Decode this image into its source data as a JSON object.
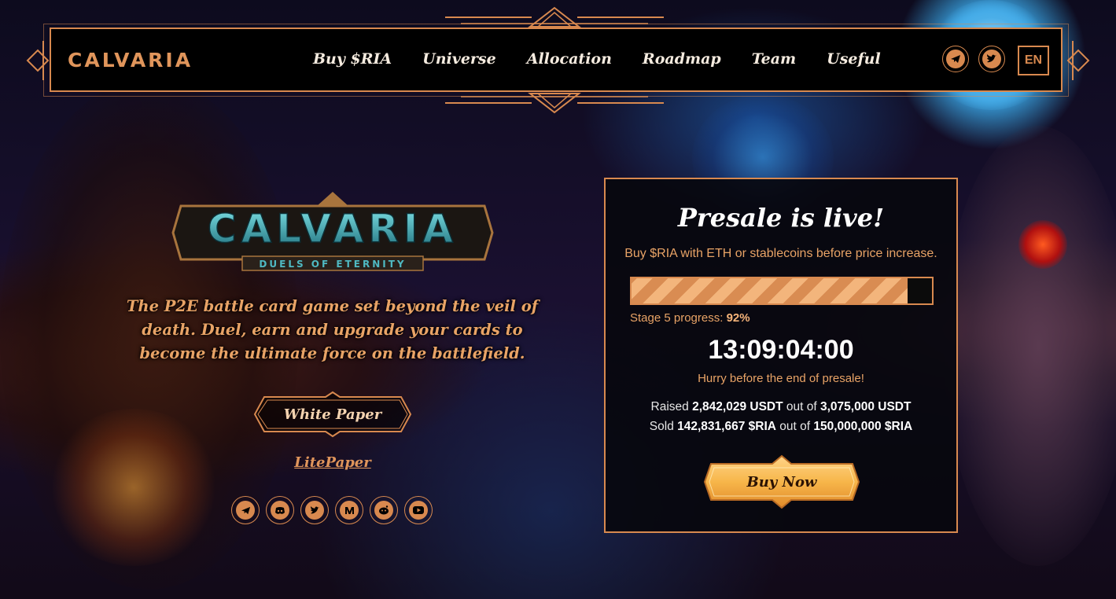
{
  "header": {
    "logo": "CALVARIA",
    "nav": [
      "Buy $RIA",
      "Universe",
      "Allocation",
      "Roadmap",
      "Team",
      "Useful"
    ],
    "social": [
      "telegram-icon",
      "twitter-icon"
    ],
    "language": "EN"
  },
  "hero": {
    "game_logo_title": "CALVARIA",
    "game_logo_subtitle": "DUELS OF ETERNITY",
    "tagline": "The P2E battle card game set beyond the veil of death. Duel, earn and upgrade your cards to become the ultimate force on the battlefield.",
    "white_paper_label": "White Paper",
    "litepaper_label": "LitePaper",
    "social": [
      "telegram-icon",
      "discord-icon",
      "twitter-icon",
      "medium-icon",
      "reddit-icon",
      "youtube-icon"
    ]
  },
  "presale": {
    "title": "Presale is live!",
    "subtitle": "Buy $RIA with ETH or stablecoins before price increase.",
    "progress_fraction": 0.92,
    "stage_label": "Stage 5 progress:",
    "stage_value": "92%",
    "countdown": "13:09:04:00",
    "hurry": "Hurry before the end of presale!",
    "raised_prefix": "Raised",
    "raised_amount": "2,842,029 USDT",
    "raised_mid": "out of",
    "raised_total": "3,075,000 USDT",
    "sold_prefix": "Sold",
    "sold_amount": "142,831,667 $RIA",
    "sold_mid": "out of",
    "sold_total": "150,000,000 $RIA",
    "buy_label": "Buy Now"
  },
  "colors": {
    "accent": "#d8894f",
    "accent_light": "#e8a366",
    "panel_bg": "#08080e",
    "button_gold": "#f7b64a"
  }
}
